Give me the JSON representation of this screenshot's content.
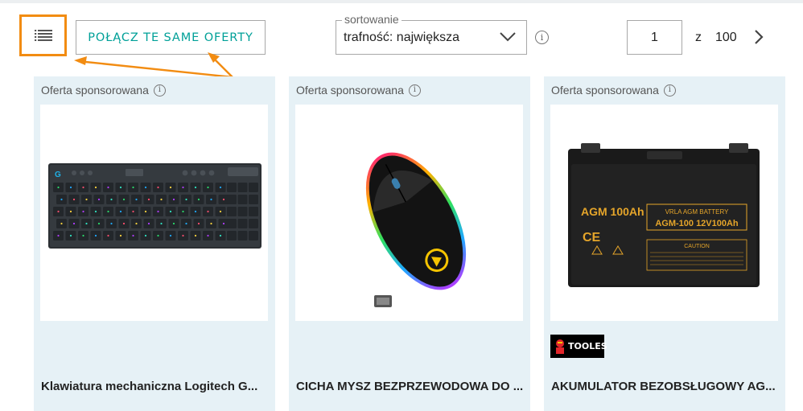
{
  "toolbar": {
    "list_view_icon": "list-icon",
    "merge_label": "POŁĄCZ TE SAME OFERTY",
    "sort_legend": "sortowanie",
    "sort_value": "trafność: największa",
    "pagination": {
      "current": "1",
      "of_label": "z",
      "total": "100"
    }
  },
  "colors": {
    "accent": "#00a098",
    "highlight": "#f28c12",
    "card_bg": "#e6f1f6"
  },
  "products": [
    {
      "sponsored_label": "Oferta sponsorowana",
      "title": "Klawiatura mechaniczna Logitech G...",
      "image": "keyboard"
    },
    {
      "sponsored_label": "Oferta sponsorowana",
      "title": "CICHA MYSZ BEZPRZEWODOWA DO ...",
      "image": "mouse"
    },
    {
      "sponsored_label": "Oferta sponsorowana",
      "title": "AKUMULATOR BEZOBSŁUGOWY AG...",
      "image": "battery",
      "seller_logo": "TOOLES",
      "battery_text": {
        "brand": "AGM 100Ah",
        "type": "VRLA AGM BATTERY",
        "model": "AGM-100 12V100Ah",
        "mark": "CE",
        "caution": "CAUTION"
      }
    }
  ]
}
